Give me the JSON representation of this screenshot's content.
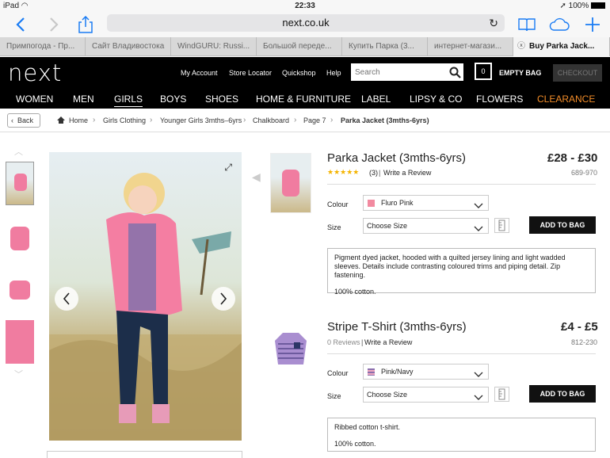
{
  "status": {
    "device": "iPad",
    "time": "22:33",
    "battery": "100%"
  },
  "safari": {
    "url": "next.co.uk"
  },
  "tabs": [
    {
      "label": "Примпогода - Пр..."
    },
    {
      "label": "Сайт Владивостока"
    },
    {
      "label": "WindGURU: Russi..."
    },
    {
      "label": "Большой переде..."
    },
    {
      "label": "Купить Парка (3..."
    },
    {
      "label": "интернет-магази..."
    },
    {
      "label": "Buy Parka Jack..."
    }
  ],
  "header": {
    "logo": "next",
    "links": [
      "My Account",
      "Store Locator",
      "Quickshop",
      "Help"
    ],
    "search_placeholder": "Search",
    "bag_count": "0",
    "bag_label": "EMPTY BAG",
    "checkout_label": "CHECKOUT"
  },
  "nav": [
    "WOMEN",
    "MEN",
    "GIRLS",
    "BOYS",
    "SHOES",
    "HOME & FURNITURE",
    "LABEL",
    "LIPSY & CO",
    "FLOWERS",
    "CLEARANCE"
  ],
  "colors": {
    "clearance": "#f28c28",
    "active_underline": "#ffffff"
  },
  "breadcrumb": {
    "back": "Back",
    "items": [
      "Home",
      "Girls Clothing",
      "Younger Girls 3mths–6yrs",
      "Chalkboard",
      "Page 7",
      "Parka Jacket (3mths-6yrs)"
    ]
  },
  "products": [
    {
      "title": "Parka Jacket (3mths-6yrs)",
      "price": "£28 - £30",
      "code": "689-970",
      "rating": 5,
      "reviews": "(3)",
      "review_link": "Write a Review",
      "colour_label": "Colour",
      "colour_value": "Fluro Pink",
      "swatch": "#f28aa0",
      "size_label": "Size",
      "size_value": "Choose Size",
      "add_label": "ADD TO BAG",
      "desc1": "Pigment dyed jacket, hooded with a quilted jersey lining and light wadded sleeves. Details include contrasting coloured trims and piping detail. Zip fastening.",
      "desc2": "100% cotton."
    },
    {
      "title": "Stripe T-Shirt (3mths-6yrs)",
      "price": "£4 - £5",
      "code": "812-230",
      "reviews": "0 Reviews",
      "review_link": "Write a Review",
      "colour_label": "Colour",
      "colour_value": "Pink/Navy",
      "swatch": "#8a6fae",
      "size_label": "Size",
      "size_value": "Choose Size",
      "add_label": "ADD TO BAG",
      "desc1": "Ribbed cotton t-shirt.",
      "desc2": "100% cotton."
    }
  ]
}
